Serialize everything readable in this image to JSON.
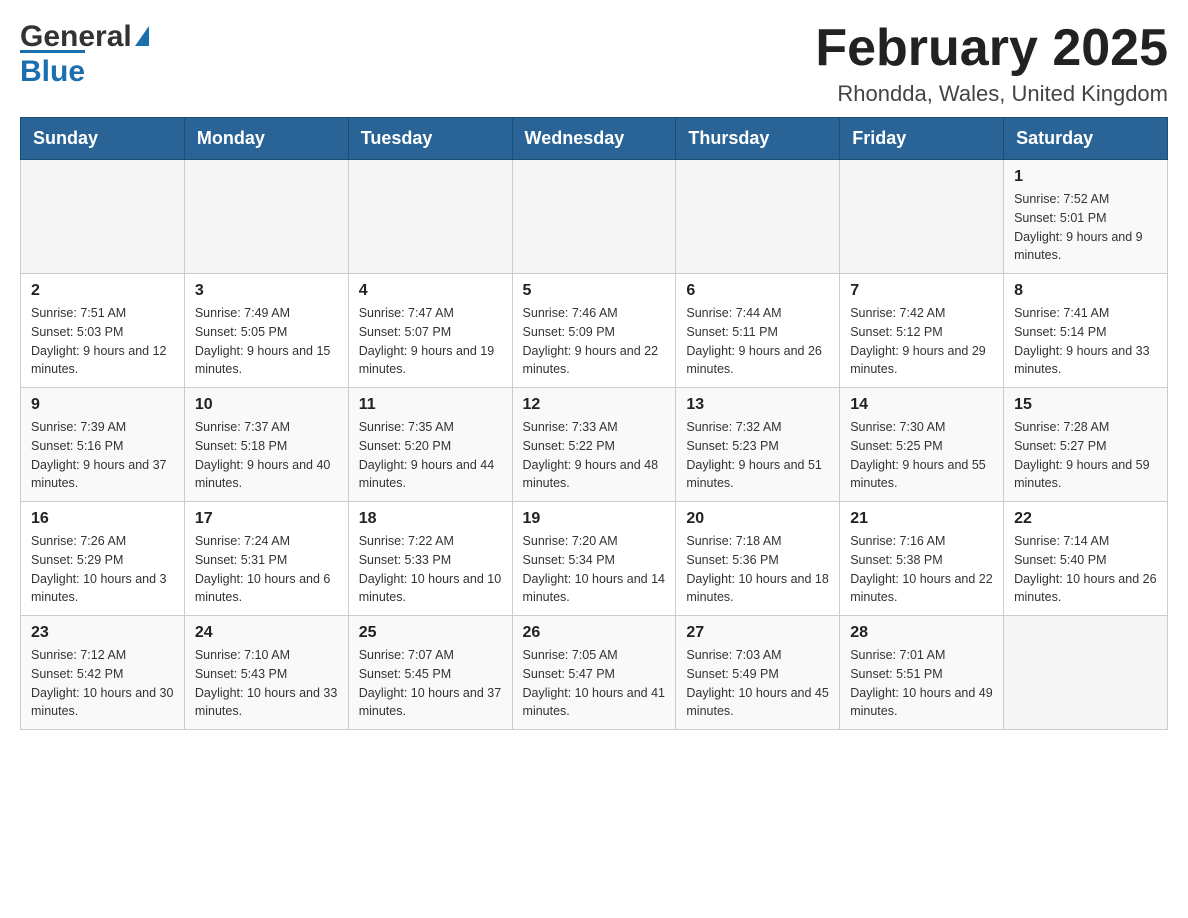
{
  "header": {
    "logo_general": "General",
    "logo_blue": "Blue",
    "title": "February 2025",
    "subtitle": "Rhondda, Wales, United Kingdom"
  },
  "weekdays": [
    "Sunday",
    "Monday",
    "Tuesday",
    "Wednesday",
    "Thursday",
    "Friday",
    "Saturday"
  ],
  "weeks": [
    [
      {
        "day": "",
        "sunrise": "",
        "sunset": "",
        "daylight": ""
      },
      {
        "day": "",
        "sunrise": "",
        "sunset": "",
        "daylight": ""
      },
      {
        "day": "",
        "sunrise": "",
        "sunset": "",
        "daylight": ""
      },
      {
        "day": "",
        "sunrise": "",
        "sunset": "",
        "daylight": ""
      },
      {
        "day": "",
        "sunrise": "",
        "sunset": "",
        "daylight": ""
      },
      {
        "day": "",
        "sunrise": "",
        "sunset": "",
        "daylight": ""
      },
      {
        "day": "1",
        "sunrise": "Sunrise: 7:52 AM",
        "sunset": "Sunset: 5:01 PM",
        "daylight": "Daylight: 9 hours and 9 minutes."
      }
    ],
    [
      {
        "day": "2",
        "sunrise": "Sunrise: 7:51 AM",
        "sunset": "Sunset: 5:03 PM",
        "daylight": "Daylight: 9 hours and 12 minutes."
      },
      {
        "day": "3",
        "sunrise": "Sunrise: 7:49 AM",
        "sunset": "Sunset: 5:05 PM",
        "daylight": "Daylight: 9 hours and 15 minutes."
      },
      {
        "day": "4",
        "sunrise": "Sunrise: 7:47 AM",
        "sunset": "Sunset: 5:07 PM",
        "daylight": "Daylight: 9 hours and 19 minutes."
      },
      {
        "day": "5",
        "sunrise": "Sunrise: 7:46 AM",
        "sunset": "Sunset: 5:09 PM",
        "daylight": "Daylight: 9 hours and 22 minutes."
      },
      {
        "day": "6",
        "sunrise": "Sunrise: 7:44 AM",
        "sunset": "Sunset: 5:11 PM",
        "daylight": "Daylight: 9 hours and 26 minutes."
      },
      {
        "day": "7",
        "sunrise": "Sunrise: 7:42 AM",
        "sunset": "Sunset: 5:12 PM",
        "daylight": "Daylight: 9 hours and 29 minutes."
      },
      {
        "day": "8",
        "sunrise": "Sunrise: 7:41 AM",
        "sunset": "Sunset: 5:14 PM",
        "daylight": "Daylight: 9 hours and 33 minutes."
      }
    ],
    [
      {
        "day": "9",
        "sunrise": "Sunrise: 7:39 AM",
        "sunset": "Sunset: 5:16 PM",
        "daylight": "Daylight: 9 hours and 37 minutes."
      },
      {
        "day": "10",
        "sunrise": "Sunrise: 7:37 AM",
        "sunset": "Sunset: 5:18 PM",
        "daylight": "Daylight: 9 hours and 40 minutes."
      },
      {
        "day": "11",
        "sunrise": "Sunrise: 7:35 AM",
        "sunset": "Sunset: 5:20 PM",
        "daylight": "Daylight: 9 hours and 44 minutes."
      },
      {
        "day": "12",
        "sunrise": "Sunrise: 7:33 AM",
        "sunset": "Sunset: 5:22 PM",
        "daylight": "Daylight: 9 hours and 48 minutes."
      },
      {
        "day": "13",
        "sunrise": "Sunrise: 7:32 AM",
        "sunset": "Sunset: 5:23 PM",
        "daylight": "Daylight: 9 hours and 51 minutes."
      },
      {
        "day": "14",
        "sunrise": "Sunrise: 7:30 AM",
        "sunset": "Sunset: 5:25 PM",
        "daylight": "Daylight: 9 hours and 55 minutes."
      },
      {
        "day": "15",
        "sunrise": "Sunrise: 7:28 AM",
        "sunset": "Sunset: 5:27 PM",
        "daylight": "Daylight: 9 hours and 59 minutes."
      }
    ],
    [
      {
        "day": "16",
        "sunrise": "Sunrise: 7:26 AM",
        "sunset": "Sunset: 5:29 PM",
        "daylight": "Daylight: 10 hours and 3 minutes."
      },
      {
        "day": "17",
        "sunrise": "Sunrise: 7:24 AM",
        "sunset": "Sunset: 5:31 PM",
        "daylight": "Daylight: 10 hours and 6 minutes."
      },
      {
        "day": "18",
        "sunrise": "Sunrise: 7:22 AM",
        "sunset": "Sunset: 5:33 PM",
        "daylight": "Daylight: 10 hours and 10 minutes."
      },
      {
        "day": "19",
        "sunrise": "Sunrise: 7:20 AM",
        "sunset": "Sunset: 5:34 PM",
        "daylight": "Daylight: 10 hours and 14 minutes."
      },
      {
        "day": "20",
        "sunrise": "Sunrise: 7:18 AM",
        "sunset": "Sunset: 5:36 PM",
        "daylight": "Daylight: 10 hours and 18 minutes."
      },
      {
        "day": "21",
        "sunrise": "Sunrise: 7:16 AM",
        "sunset": "Sunset: 5:38 PM",
        "daylight": "Daylight: 10 hours and 22 minutes."
      },
      {
        "day": "22",
        "sunrise": "Sunrise: 7:14 AM",
        "sunset": "Sunset: 5:40 PM",
        "daylight": "Daylight: 10 hours and 26 minutes."
      }
    ],
    [
      {
        "day": "23",
        "sunrise": "Sunrise: 7:12 AM",
        "sunset": "Sunset: 5:42 PM",
        "daylight": "Daylight: 10 hours and 30 minutes."
      },
      {
        "day": "24",
        "sunrise": "Sunrise: 7:10 AM",
        "sunset": "Sunset: 5:43 PM",
        "daylight": "Daylight: 10 hours and 33 minutes."
      },
      {
        "day": "25",
        "sunrise": "Sunrise: 7:07 AM",
        "sunset": "Sunset: 5:45 PM",
        "daylight": "Daylight: 10 hours and 37 minutes."
      },
      {
        "day": "26",
        "sunrise": "Sunrise: 7:05 AM",
        "sunset": "Sunset: 5:47 PM",
        "daylight": "Daylight: 10 hours and 41 minutes."
      },
      {
        "day": "27",
        "sunrise": "Sunrise: 7:03 AM",
        "sunset": "Sunset: 5:49 PM",
        "daylight": "Daylight: 10 hours and 45 minutes."
      },
      {
        "day": "28",
        "sunrise": "Sunrise: 7:01 AM",
        "sunset": "Sunset: 5:51 PM",
        "daylight": "Daylight: 10 hours and 49 minutes."
      },
      {
        "day": "",
        "sunrise": "",
        "sunset": "",
        "daylight": ""
      }
    ]
  ]
}
